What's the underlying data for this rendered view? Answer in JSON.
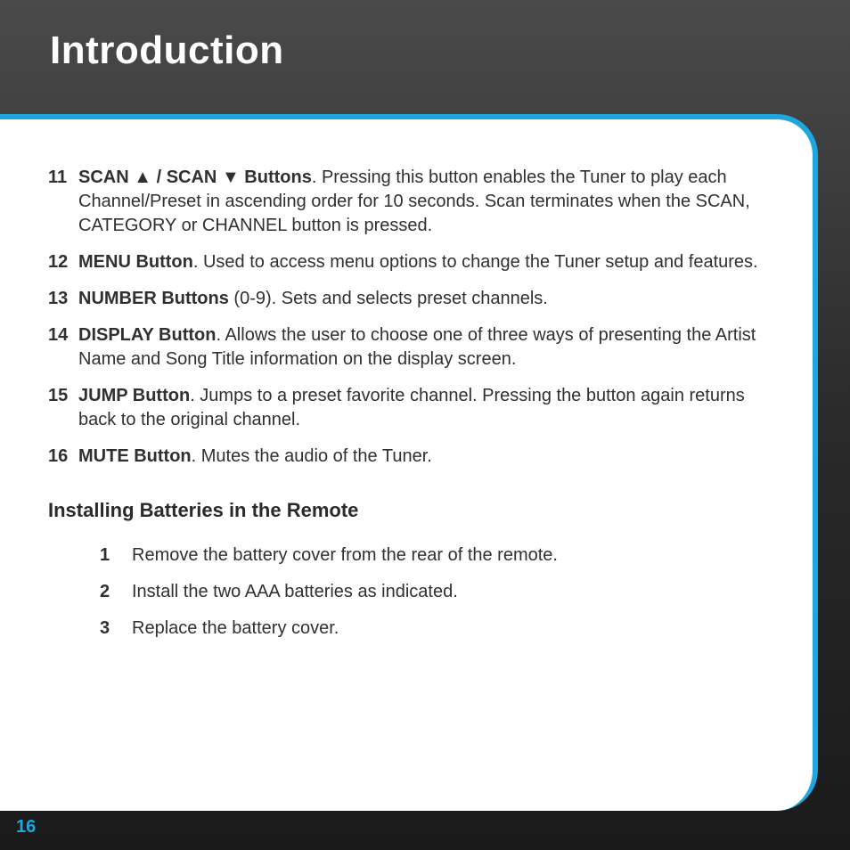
{
  "title": "Introduction",
  "items": [
    {
      "num": "11",
      "label_pre": "SCAN ",
      "label_mid": " / SCAN ",
      "label_post": " Buttons",
      "desc": ". Pressing this button enables the Tuner to play each Channel/Preset in ascending order for 10 seconds. Scan terminates when the SCAN, CATEGORY or CHANNEL button is pressed.",
      "arrows": true
    },
    {
      "num": "12",
      "label": "MENU Button",
      "desc": ". Used to access menu options to change the Tuner setup and features."
    },
    {
      "num": "13",
      "label": "NUMBER Buttons",
      "suffix": " (0-9)",
      "desc": ". Sets and selects preset channels."
    },
    {
      "num": "14",
      "label": "DISPLAY Button",
      "desc": ". Allows the user to choose one of three ways of presenting the Artist Name and Song Title information on the display screen."
    },
    {
      "num": "15",
      "label": "JUMP Button",
      "desc": ". Jumps to a preset favorite channel. Pressing the button again returns back to the original channel."
    },
    {
      "num": "16",
      "label": "MUTE Button",
      "desc": ". Mutes the audio of the Tuner."
    }
  ],
  "sectionHeading": "Installing Batteries in the Remote",
  "steps": [
    {
      "num": "1",
      "text": "Remove the battery cover from the rear of the remote."
    },
    {
      "num": "2",
      "text": "Install the two AAA batteries as indicated."
    },
    {
      "num": "3",
      "text": "Replace the battery cover."
    }
  ],
  "pageNumber": "16",
  "glyphs": {
    "up": "▲",
    "down": "▼"
  }
}
